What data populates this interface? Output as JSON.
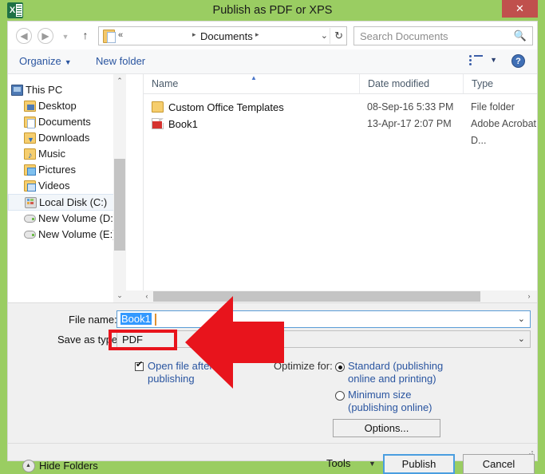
{
  "window": {
    "title": "Publish as PDF or XPS",
    "app_icon": "excel-icon",
    "close_label": "✕"
  },
  "nav": {
    "back_icon": "◀",
    "forward_icon": "▶",
    "recent_icon": "▼",
    "up_icon": "↑",
    "address": {
      "icon": "documents-folder-icon",
      "overflow": "«",
      "separator": "▸",
      "crumb": "Documents",
      "dropdown_icon": "⌄",
      "refresh_icon": "↻"
    },
    "search": {
      "placeholder": "Search Documents",
      "icon": "search-icon"
    }
  },
  "commandbar": {
    "organize": "Organize",
    "organize_chevron": "▼",
    "new_folder": "New folder",
    "view_icon": "list-view-icon",
    "view_chevron": "▼",
    "help_icon": "?"
  },
  "navpane": {
    "items": [
      {
        "label": "This PC",
        "icon": "computer-icon",
        "level": 0,
        "selected": false
      },
      {
        "label": "Desktop",
        "icon": "desktop-folder-icon",
        "level": 1,
        "selected": false
      },
      {
        "label": "Documents",
        "icon": "documents-folder-icon",
        "level": 1,
        "selected": false
      },
      {
        "label": "Downloads",
        "icon": "downloads-folder-icon",
        "level": 1,
        "selected": false
      },
      {
        "label": "Music",
        "icon": "music-folder-icon",
        "level": 1,
        "selected": false
      },
      {
        "label": "Pictures",
        "icon": "pictures-folder-icon",
        "level": 1,
        "selected": false
      },
      {
        "label": "Videos",
        "icon": "videos-folder-icon",
        "level": 1,
        "selected": false
      },
      {
        "label": "Local Disk (C:)",
        "icon": "system-disk-icon",
        "level": 1,
        "selected": true
      },
      {
        "label": "New Volume (D:)",
        "icon": "drive-icon",
        "level": 1,
        "selected": false
      },
      {
        "label": "New Volume (E:)",
        "icon": "drive-icon",
        "level": 1,
        "selected": false
      }
    ],
    "scroll_up_icon": "⌃",
    "scroll_down_icon": "⌄"
  },
  "filelist": {
    "columns": [
      "Name",
      "Date modified",
      "Type"
    ],
    "sort_indicator": "▲",
    "rows": [
      {
        "name": "Custom Office Templates",
        "date": "08-Sep-16 5:33 PM",
        "type": "File folder",
        "icon": "folder-icon"
      },
      {
        "name": "Book1",
        "date": "13-Apr-17 2:07 PM",
        "type": "Adobe Acrobat D...",
        "icon": "pdf-file-icon"
      }
    ],
    "hscroll_left_icon": "‹",
    "hscroll_right_icon": "›"
  },
  "form": {
    "filename_label": "File name:",
    "filename_value": "Book1",
    "filename_chevron": "⌄",
    "savetype_label": "Save as type:",
    "savetype_value": "PDF",
    "savetype_chevron": "⌄",
    "open_after_label": "Open file after publishing",
    "open_after_checked": true,
    "optimize_label": "Optimize for:",
    "radio_standard": "Standard (publishing online and printing)",
    "radio_minimum": "Minimum size (publishing online)",
    "selected_optimize": "Standard (publishing online and printing)",
    "options_button": "Options..."
  },
  "footer": {
    "hide_folders": "Hide Folders",
    "hide_folders_icon": "collapse-icon",
    "tools": "Tools",
    "tools_chevron": "▼",
    "publish": "Publish",
    "cancel": "Cancel"
  },
  "annotations": {
    "highlight_color": "#E8141C",
    "arrow_color": "#E8141C",
    "highlight_target": "Save as type: PDF",
    "arrow_direction": "left"
  },
  "colors": {
    "window_frame": "#9ACD62",
    "close_button": "#C0504D",
    "link_blue": "#2a55a0",
    "selection_blue": "#3399ff",
    "focus_border": "#4a9ee0"
  }
}
